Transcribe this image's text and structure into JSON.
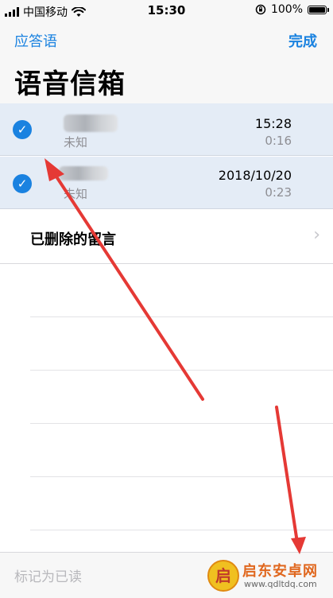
{
  "status_bar": {
    "carrier": "中国移动",
    "time": "15:30",
    "battery": "100%",
    "battery_level": 1.0,
    "icons": [
      "signal-icon",
      "wifi-icon",
      "rotation-lock-icon",
      "battery-icon"
    ]
  },
  "nav": {
    "back_label": "应答语",
    "done_label": "完成"
  },
  "page": {
    "title": "语音信箱"
  },
  "voicemails": [
    {
      "caller": "未知",
      "time": "15:28",
      "duration": "0:16",
      "selected": true
    },
    {
      "caller": "未知",
      "time": "2018/10/20",
      "duration": "0:23",
      "selected": true
    }
  ],
  "deleted": {
    "label": "已删除的留言"
  },
  "toolbar": {
    "mark_read_label": "标记为已读"
  },
  "watermark": {
    "logo_char": "启",
    "name": "启东安卓网",
    "url": "www.qdltdq.com"
  },
  "colors": {
    "accent": "#1a82e0",
    "selected_row": "#e4ecf6",
    "annotation_arrow": "#e53935"
  }
}
